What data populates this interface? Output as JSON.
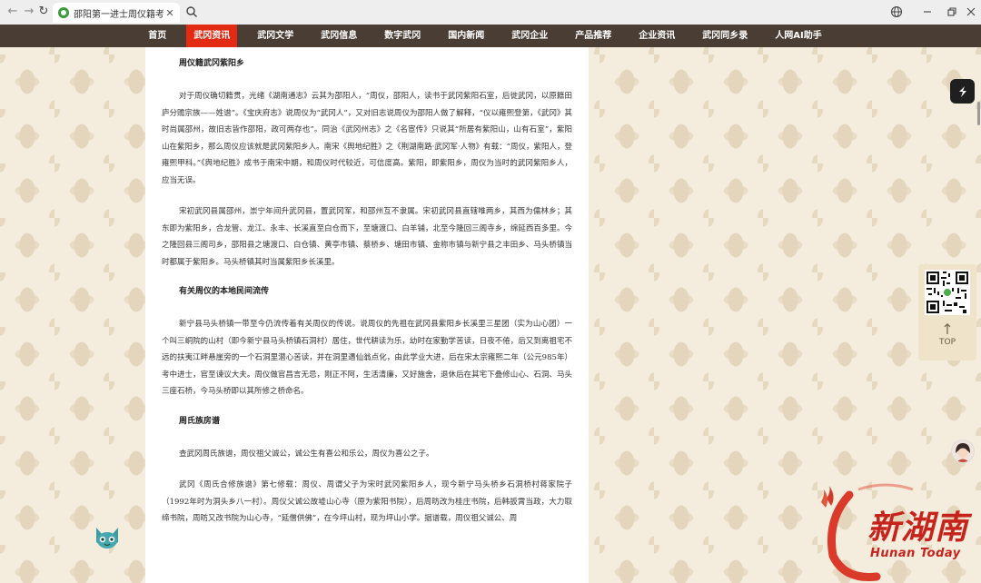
{
  "browser": {
    "tab_title": "邵阳第一进士周仪籍考 ——邵",
    "close_glyph": "✕",
    "back_glyph": "←",
    "forward_glyph": "→",
    "reload_glyph": "↻"
  },
  "nav": {
    "items": [
      {
        "label": "首页"
      },
      {
        "label": "武冈资讯"
      },
      {
        "label": "武冈文学"
      },
      {
        "label": "武冈信息"
      },
      {
        "label": "数字武冈"
      },
      {
        "label": "国内新闻"
      },
      {
        "label": "武冈企业"
      },
      {
        "label": "产品推荐"
      },
      {
        "label": "企业资讯"
      },
      {
        "label": "武冈同乡录"
      },
      {
        "label": "人网AI助手"
      }
    ],
    "active_index": 1,
    "bg_color": "#4a3d33",
    "active_color": "#e32a12"
  },
  "article": {
    "sections": [
      {
        "title": "周仪籍武冈紫阳乡",
        "paragraphs": [
          "对于周仪确切籍贯，光绪《湖南通志》云其为邵阳人，“周仪，邵阳人，读书于武冈紫阳石室，后徙武冈，以原籍田庐分赡宗族——姓谱”。《宝庆府志》说周仪为“武冈人”，又对旧志说周仪为邵阳人做了解释，“仪以雍熙登第，《武冈》其时尚属邵州，故旧志皆作邵阳，政可两存也”。同治《武冈州志》之《名宦传》只说其“所居有紫阳山，山有石室”，紫阳山在紫阳乡，那么周仪应该就是武冈紫阳乡人。南宋《舆地纪胜》之《荆湖南路·武冈军·人物》有载：“周仪，紫阳人，登雍熙甲科。”《舆地纪胜》成书于南宋中期，和周仪时代较近，可信度高。紫阳，即紫阳乡，周仪为当时的武冈紫阳乡人，应当无误。",
          "宋初武冈县属邵州，崇宁年间升武冈县，置武冈军，和邵州互不隶属。宋初武冈县直辖唯两乡，其西为儒林乡；其东即为紫阳乡，合龙管、龙江、永丰、长溪直至白仓而下，至塘渡口、白羊铺，北至今隆回三阁寺乡，绵延西百多里。今之隆回县三阁司乡，邵阳县之塘渡口、白仓镇、黄亭市镇、蔡桥乡、塘田市镇、金称市镇与新宁县之丰田乡、马头桥镇当时都属于紫阳乡。马头桥镇其时当属紫阳乡长溪里。"
        ]
      },
      {
        "title": "有关周仪的本地民间流传",
        "paragraphs": [
          "新宁县马头桥镇一带至今仍流传着有关周仪的传说。说周仪的先祖在武冈县紫阳乡长溪里三星团（实为山心团）一个叫三峒院的山村（即今新宁县马头桥镇石洞村）居住，世代耕读为乐，幼时在家勤学苦读，日夜不倦，后又到离祖宅不远的扶夷江畔悬崖旁的一个石洞里潜心苦读，并在洞里遇仙翁点化，由此学业大进，后在宋太宗雍熙二年（公元985年）考中进士，官至谏议大夫。周仪做官昌言无忌，刚正不阿，生活清廉，又好施舍，退休后在其宅下叠修山心、石洞、马头三座石桥，今马头桥即以其所修之桥命名。"
        ]
      },
      {
        "title": "周氏族房谱",
        "paragraphs": [
          "查武冈周氏族谱，周仪祖父诚公，诚公生有喜公和乐公，周仪为喜公之子。",
          "武冈《周氏合修族谱》第七修载：周仪、周谓父子为宋时武冈紫阳乡人，现今新宁马头桥乡石洞桥村蒋家院子（1992年时为洞头乡八一村）。周仪父诚公故墟山心寺（原为紫阳书院），后周昉改为桂庄书院，后韩扳霄当政，大力取缔书院，周昉又改书院为山心寺，“延僧供佛”，在今坪山村，现为坪山小学。据谱载，周仪祖父诚公、周"
        ]
      }
    ]
  },
  "side": {
    "top_label": "TOP",
    "top_arrow_glyph": "↑"
  },
  "logo": {
    "name_cn": "新湖南",
    "name_en": "Hunan Today"
  }
}
